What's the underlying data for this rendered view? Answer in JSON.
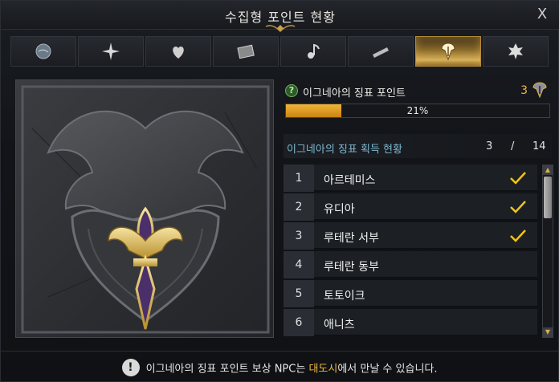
{
  "window": {
    "title": "수집형 포인트 현황",
    "close_label": "X"
  },
  "tabs": [
    {
      "icon": "island-globe-icon",
      "active": false
    },
    {
      "icon": "star-compass-icon",
      "active": false
    },
    {
      "icon": "heart-seed-icon",
      "active": false
    },
    {
      "icon": "painting-frame-icon",
      "active": false
    },
    {
      "icon": "music-note-icon",
      "active": false
    },
    {
      "icon": "telescope-icon",
      "active": false
    },
    {
      "icon": "ignea-emblem-icon",
      "active": true
    },
    {
      "icon": "leaf-icon",
      "active": false
    }
  ],
  "points": {
    "label": "이그네아의 징표 포인트",
    "count": "3",
    "progress_text": "21%",
    "progress_value": 21
  },
  "status": {
    "label": "이그네아의 징표 획득 현황",
    "current": "3",
    "separator": "/",
    "total": "14"
  },
  "rows": [
    {
      "num": "1",
      "name": "아르테미스",
      "obtained": true
    },
    {
      "num": "2",
      "name": "유디아",
      "obtained": true
    },
    {
      "num": "3",
      "name": "루테란 서부",
      "obtained": true
    },
    {
      "num": "4",
      "name": "루테란 동부",
      "obtained": false
    },
    {
      "num": "5",
      "name": "토토이크",
      "obtained": false
    },
    {
      "num": "6",
      "name": "애니츠",
      "obtained": false
    }
  ],
  "footer": {
    "prefix": "이그네아의 징표 포인트 보상 NPC는 ",
    "highlight": "대도시",
    "suffix": "에서 만날 수 있습니다."
  },
  "colors": {
    "accent": "#f2b73c",
    "check": "#f0c419",
    "status_label": "#7fb7cf"
  }
}
